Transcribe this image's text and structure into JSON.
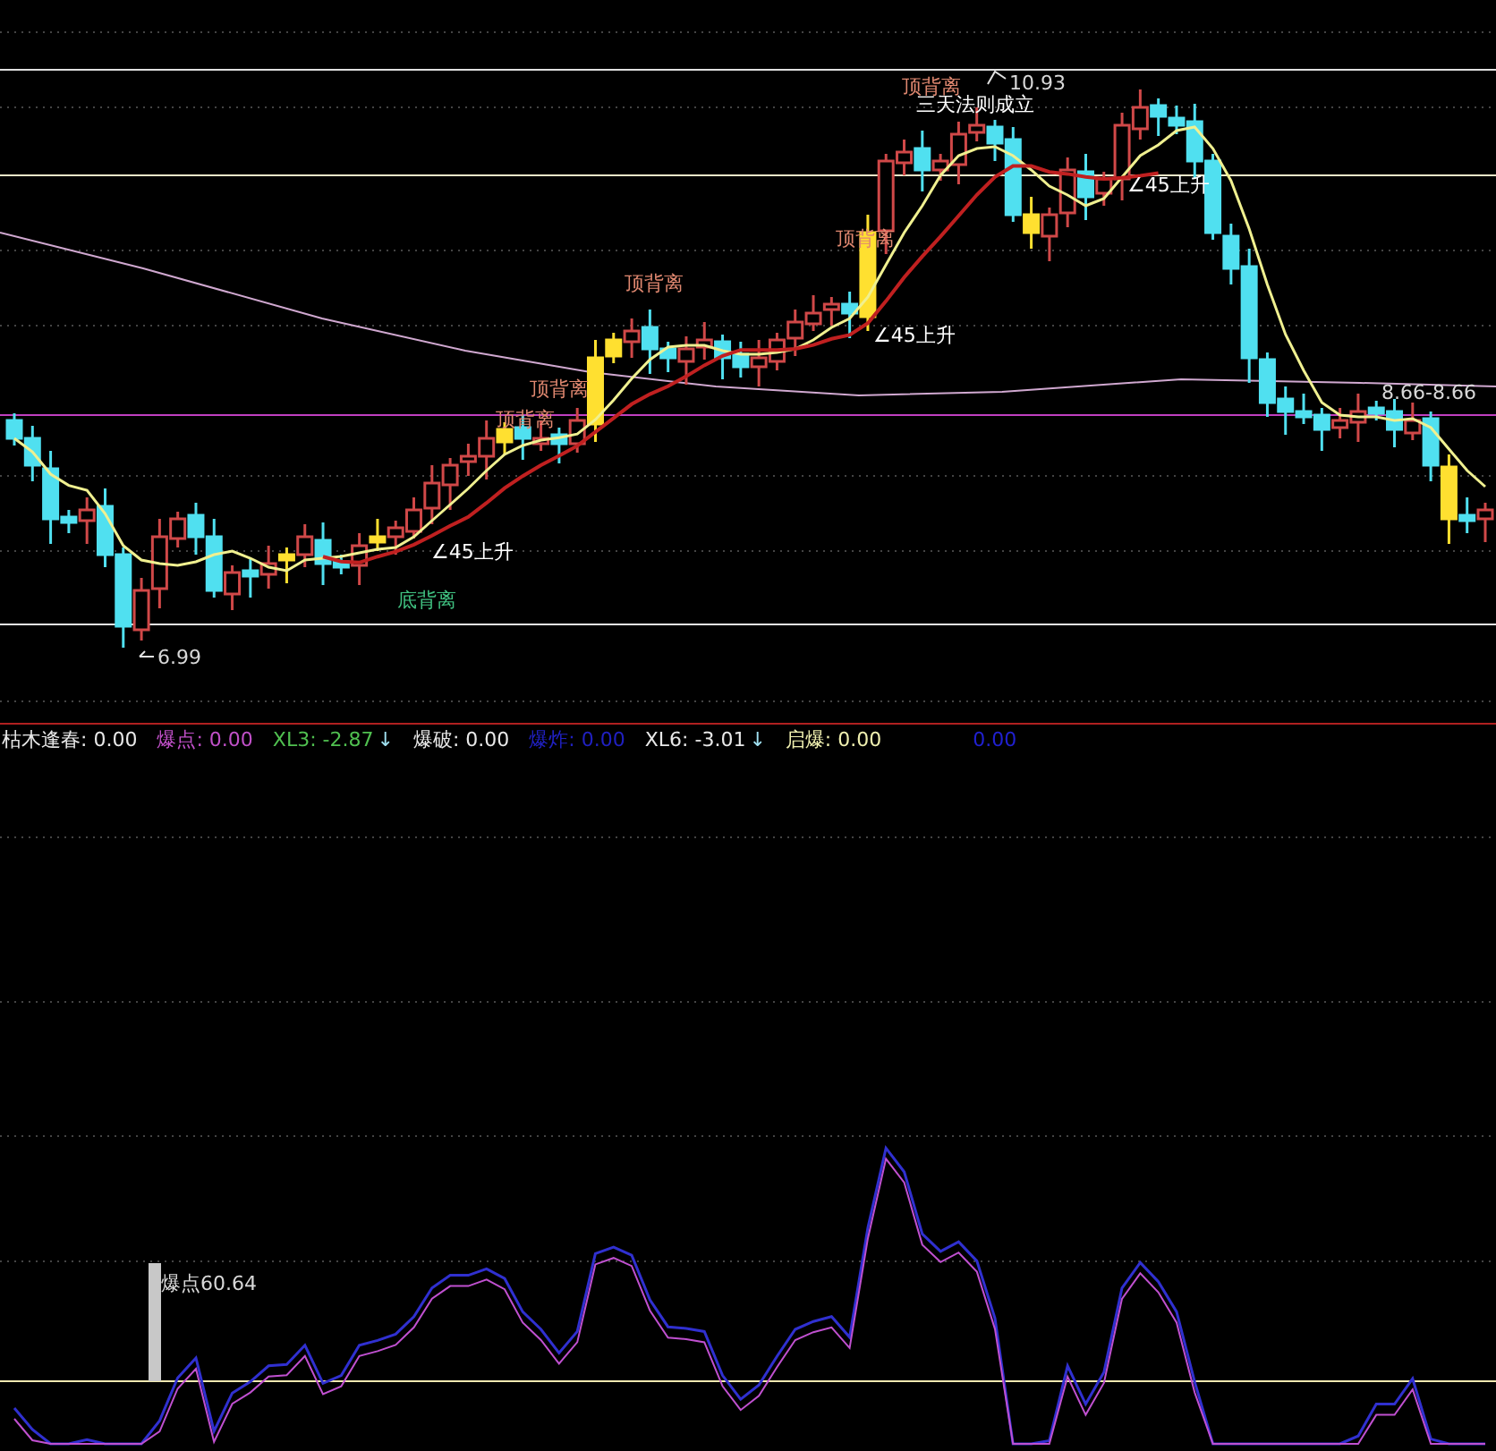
{
  "price_chart": {
    "annotations": [
      {
        "text": "顶背离",
        "kind": "top"
      },
      {
        "text": "三天法则成立",
        "kind": "signal"
      },
      {
        "text": "10.93",
        "kind": "price"
      },
      {
        "text": "顶背离",
        "kind": "top"
      },
      {
        "text": "∠45上升",
        "kind": "signal"
      },
      {
        "text": "顶背离",
        "kind": "top"
      },
      {
        "text": "∠45上升",
        "kind": "signal"
      },
      {
        "text": "顶背离",
        "kind": "top"
      },
      {
        "text": "顶背离",
        "kind": "top"
      },
      {
        "text": "∠45上升",
        "kind": "signal"
      },
      {
        "text": "底背离",
        "kind": "bottom"
      },
      {
        "text": "8.66-8.66",
        "kind": "price"
      },
      {
        "text": "6.99",
        "kind": "price"
      }
    ]
  },
  "indicators": [
    {
      "label": "枯木逢春: 0.00",
      "color": "#e8e8e8"
    },
    {
      "label": "爆点: 0.00",
      "color": "#c050c8"
    },
    {
      "label": "XL3: -2.87",
      "color": "#50c050",
      "arrow": "↓"
    },
    {
      "label": "爆破: 0.00",
      "color": "#e8e8e8"
    },
    {
      "label": "爆炸: 0.00",
      "color": "#2020c0"
    },
    {
      "label": "XL6: -3.01",
      "color": "#e8e8e8",
      "arrow": "↓"
    },
    {
      "label": "启爆: 0.00",
      "color": "#f0f0b0"
    },
    {
      "label": "0.00",
      "color": "#2020d0"
    }
  ],
  "oscillator": {
    "label": "爆点60.64"
  }
}
